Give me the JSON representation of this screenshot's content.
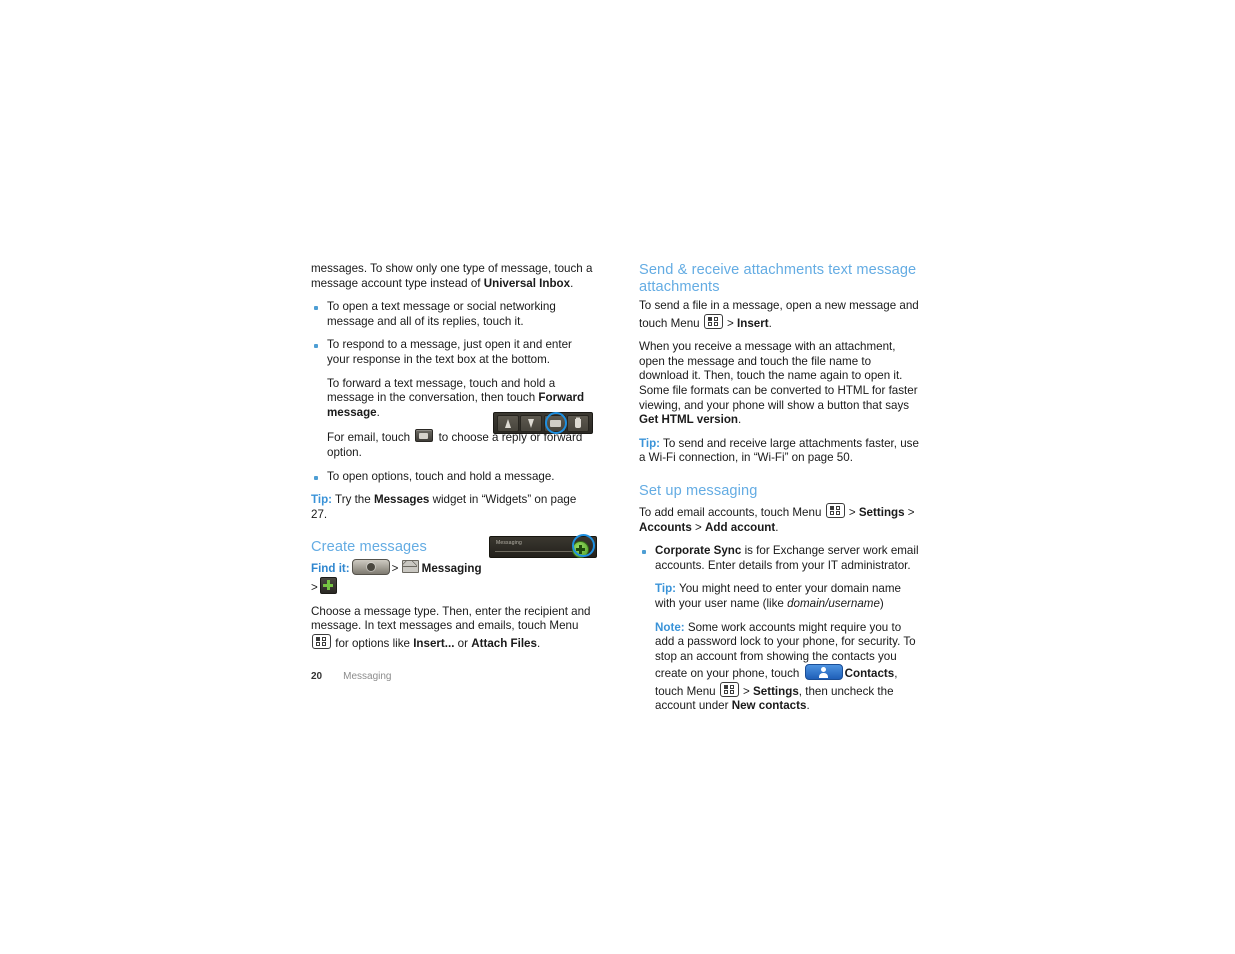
{
  "document": {
    "type": "user-guide-page",
    "page_number": "20",
    "footer_section": "Messaging",
    "accent_heading_color": "#64ace3",
    "accent_label_color": "#3a93d8",
    "bullet_color": "#4e9ed4",
    "highlight_ring_color": "#1e8fe0"
  },
  "left_column": {
    "intro": {
      "text_before_bold": "messages. To show only one type of message, touch a message account type instead of ",
      "bold": "Universal Inbox",
      "text_after_bold": "."
    },
    "bullets": [
      {
        "text": "To open a text message or social networking message and all of its replies, touch it."
      },
      {
        "text": "To respond to a message, just open it and enter your response in the text box at the bottom."
      }
    ],
    "sub_paragraphs": [
      {
        "text_before_bold": "To forward a text message, touch and hold a message in the conversation, then touch ",
        "bold": "Forward message",
        "text_after_bold": "."
      },
      {
        "text_before_icon": "For email, touch ",
        "icon": "email-key-icon",
        "text_after_icon": " to choose a reply or forward option."
      }
    ],
    "bullet_last": {
      "text": "To open options, touch and hold a message."
    },
    "tip": {
      "label": "Tip:",
      "text_before_bold": " Try the ",
      "bold": "Messages",
      "text_after_bold": " widget in “Widgets” on page 27."
    },
    "create_messages": {
      "heading": "Create messages",
      "find_it_label": "Find it:",
      "find_it_sep_1": ">",
      "find_it_app": "Messaging",
      "find_it_sep_2": ">",
      "body": {
        "text_before_menu": "Choose a message type. Then, enter the recipient and message. In text messages and emails, touch Menu ",
        "text_after_menu": " for options like ",
        "bold_1": "Insert...",
        "mid": " or ",
        "bold_2": "Attach Files",
        "end": "."
      }
    },
    "figures": {
      "email_toolbar": {
        "name": "email-action-toolbar",
        "keys": [
          "up-arrow-icon",
          "down-arrow-icon",
          "envelope-icon",
          "trash-icon"
        ],
        "highlighted_key": "envelope-icon"
      },
      "messaging_bar": {
        "name": "messaging-list-header",
        "label": "Messaging",
        "button": "new-message-plus-icon",
        "highlighted": true
      }
    }
  },
  "right_column": {
    "attachments": {
      "heading": "Send & receive attachments text message attachments",
      "para_1": {
        "text_before_menu": "To send a file in a message, open a new message and touch Menu ",
        "text_after_menu": " > ",
        "bold": "Insert",
        "end": "."
      },
      "para_2": {
        "text_before_bold": "When you receive a message with an attachment, open the message and touch the file name to download it. Then, touch the name again to open it. Some file formats can be converted to HTML for faster viewing, and your phone will show a button that says ",
        "bold": "Get HTML version",
        "text_after_bold": "."
      },
      "tip": {
        "label": "Tip:",
        "text": " To send and receive large attachments faster, use a Wi-Fi connection, in “Wi-Fi” on page 50."
      }
    },
    "set_up_messaging": {
      "heading": "Set up messaging",
      "intro": {
        "text_before_menu": "To add email accounts, touch Menu ",
        "text_after_menu": " > ",
        "bold_1": "Settings",
        "sep_1": " > ",
        "bold_2": "Accounts",
        "sep_2": " > ",
        "bold_3": "Add account",
        "end": "."
      },
      "bullet": {
        "bold": "Corporate Sync",
        "text": " is for Exchange server work email accounts. Enter details from your IT administrator."
      },
      "tip": {
        "label": "Tip:",
        "text_before_italic": " You might need to enter your domain name with your user name (like ",
        "italic": "domain/username",
        "text_after_italic": ")"
      },
      "note": {
        "label": "Note:",
        "text_before_chip": " Some work accounts might require you to add a password lock to your phone, for security. To stop an account from showing the contacts you create on your phone, touch ",
        "chip_label": "Contacts",
        "text_after_chip": ", touch Menu ",
        "text_after_menu": " > ",
        "bold_1": "Settings",
        "mid": ", then uncheck the account under ",
        "bold_2": "New contacts",
        "end": "."
      }
    }
  }
}
